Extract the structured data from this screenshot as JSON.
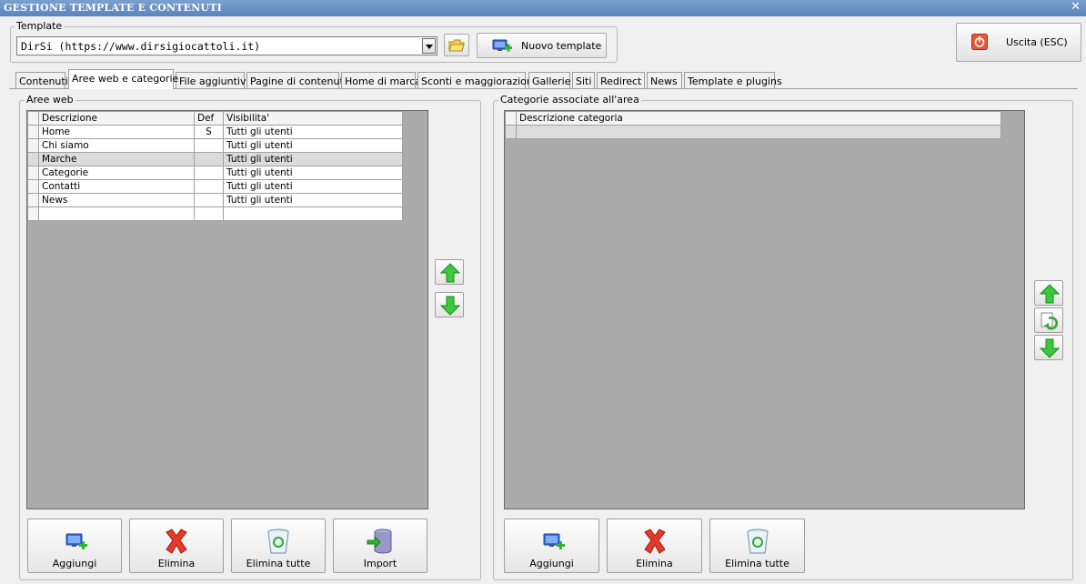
{
  "window": {
    "title": "GESTIONE TEMPLATE E CONTENUTI",
    "close_glyph": "✕"
  },
  "template_group": {
    "label": "Template",
    "selected": "DirSi (https://www.dirsigiocattoli.it)",
    "new_template_label": "Nuovo template"
  },
  "exit_button": {
    "label": "Uscita (ESC)"
  },
  "tabs": [
    "Contenuti",
    "Aree web e categorie",
    "File aggiuntivi",
    "Pagine di contenuti",
    "Home di marca",
    "Sconti e maggiorazioni",
    "Gallerie",
    "Siti",
    "Redirect",
    "News",
    "Template e plugins"
  ],
  "active_tab": "Aree web e categorie",
  "aree_web": {
    "label": "Aree web",
    "columns": [
      "Descrizione",
      "Def",
      "Visibilita'"
    ],
    "rows": [
      {
        "descrizione": "Home",
        "def": "S",
        "visibilita": "Tutti gli utenti"
      },
      {
        "descrizione": "Chi siamo",
        "def": "",
        "visibilita": "Tutti gli utenti"
      },
      {
        "descrizione": "Marche",
        "def": "",
        "visibilita": "Tutti gli utenti"
      },
      {
        "descrizione": "Categorie",
        "def": "",
        "visibilita": "Tutti gli utenti"
      },
      {
        "descrizione": "Contatti",
        "def": "",
        "visibilita": "Tutti gli utenti"
      },
      {
        "descrizione": "News",
        "def": "",
        "visibilita": "Tutti gli utenti"
      }
    ],
    "buttons": {
      "add": "Aggiungi",
      "delete": "Elimina",
      "delete_all": "Elimina tutte",
      "import": "Import"
    }
  },
  "categorie": {
    "label": "Categorie associate all'area",
    "columns": [
      "Descrizione categoria"
    ],
    "buttons": {
      "add": "Aggiungi",
      "delete": "Elimina",
      "delete_all": "Elimina tutte"
    }
  },
  "colors": {
    "title_bar": "#5a84bc",
    "grid_bg": "#ababab",
    "selected_row": "#dcdcdc",
    "arrow_green": "#3cc73c",
    "delete_red": "#e53a2a"
  },
  "icons": [
    "folder-icon",
    "add-monitor-icon",
    "exit-icon",
    "arrow-up-icon",
    "arrow-down-icon",
    "recycle-icon",
    "delete-icon",
    "recycle-bin-icon",
    "database-import-icon"
  ]
}
